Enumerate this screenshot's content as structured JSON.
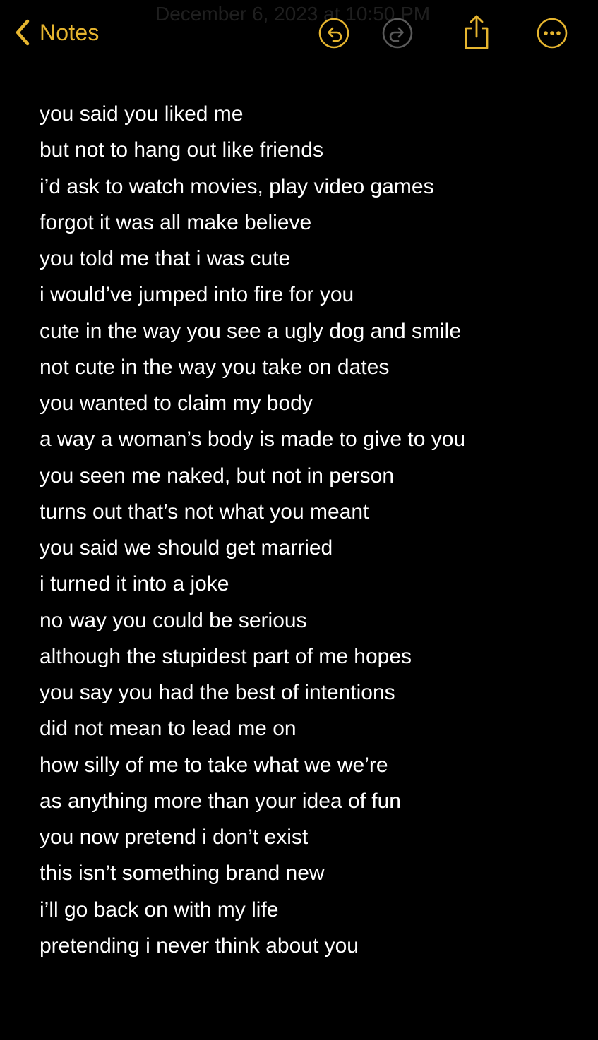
{
  "colors": {
    "background": "#000000",
    "accent": "#E6B52F",
    "disabled": "#5a5a5a",
    "text": "#ffffff"
  },
  "nav": {
    "back_label": "Notes",
    "faded_title": "December 6, 2023 at 10:50 PM",
    "icons": {
      "back": "chevron-left-icon",
      "undo": "undo-icon",
      "redo": "redo-icon",
      "share": "share-icon",
      "more": "more-icon"
    }
  },
  "note": {
    "lines": [
      "you said you liked me",
      "but not to hang out like friends",
      "i’d ask to watch movies, play video games",
      "forgot it was all make believe",
      "you told me that i was cute",
      "i would’ve jumped into fire for you",
      "cute in the way you see a ugly dog and smile",
      "not cute in the way you take on dates",
      "you wanted to claim my body",
      "a way a woman’s body is made to give to you",
      "you seen me naked, but not in person",
      "turns out that’s not what you meant",
      "you said we should get married",
      "i turned it into a joke",
      "no way you could be serious",
      "although the stupidest part of me hopes",
      "you say you had the best of intentions",
      "did not mean to lead me on",
      "how silly of me to take what we we’re",
      "as anything more than your idea of fun",
      "you now pretend i don’t exist",
      "this isn’t something brand new",
      "i’ll go back on with my life",
      "pretending i never think about you"
    ]
  }
}
